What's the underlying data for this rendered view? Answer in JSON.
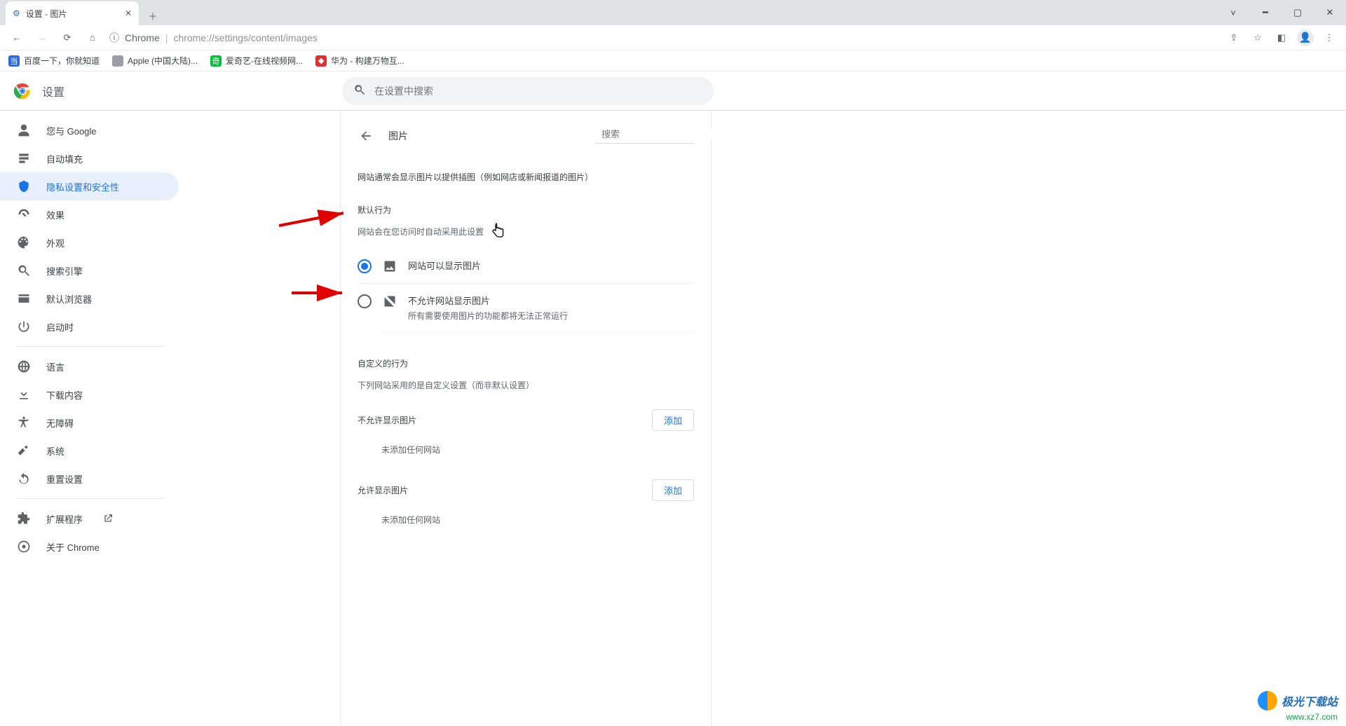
{
  "window": {
    "tab_title": "设置 - 图片",
    "url_origin": "Chrome",
    "url_path": "chrome://settings/content/images"
  },
  "bookmarks": [
    {
      "label": "百度一下，你就知道"
    },
    {
      "label": "Apple (中国大陆)..."
    },
    {
      "label": "爱奇艺-在线视频网..."
    },
    {
      "label": "华为 - 构建万物互..."
    }
  ],
  "app": {
    "title": "设置",
    "search_placeholder": "在设置中搜索"
  },
  "sidebar": {
    "items": [
      {
        "label": "您与 Google"
      },
      {
        "label": "自动填充"
      },
      {
        "label": "隐私设置和安全性"
      },
      {
        "label": "效果"
      },
      {
        "label": "外观"
      },
      {
        "label": "搜索引擎"
      },
      {
        "label": "默认浏览器"
      },
      {
        "label": "启动时"
      }
    ],
    "advanced": [
      {
        "label": "语言"
      },
      {
        "label": "下载内容"
      },
      {
        "label": "无障碍"
      },
      {
        "label": "系统"
      },
      {
        "label": "重置设置"
      }
    ],
    "bottom": [
      {
        "label": "扩展程序"
      },
      {
        "label": "关于 Chrome"
      }
    ]
  },
  "panel": {
    "title": "图片",
    "search_placeholder": "搜索",
    "description": "网站通常会显示图片以提供插图（例如网店或新闻报道的图片）",
    "default_section": "默认行为",
    "default_sub": "网站会在您访问时自动采用此设置",
    "radio_allow": "网站可以显示图片",
    "radio_block": "不允许网站显示图片",
    "radio_block_sub": "所有需要使用图片的功能都将无法正常运行",
    "custom_section": "自定义的行为",
    "custom_sub": "下列网站采用的是自定义设置（而非默认设置）",
    "block_list_title": "不允许显示图片",
    "allow_list_title": "允许显示图片",
    "add_button": "添加",
    "empty_text": "未添加任何网站"
  },
  "watermark": {
    "brand": "极光下载站",
    "url": "www.xz7.com"
  }
}
